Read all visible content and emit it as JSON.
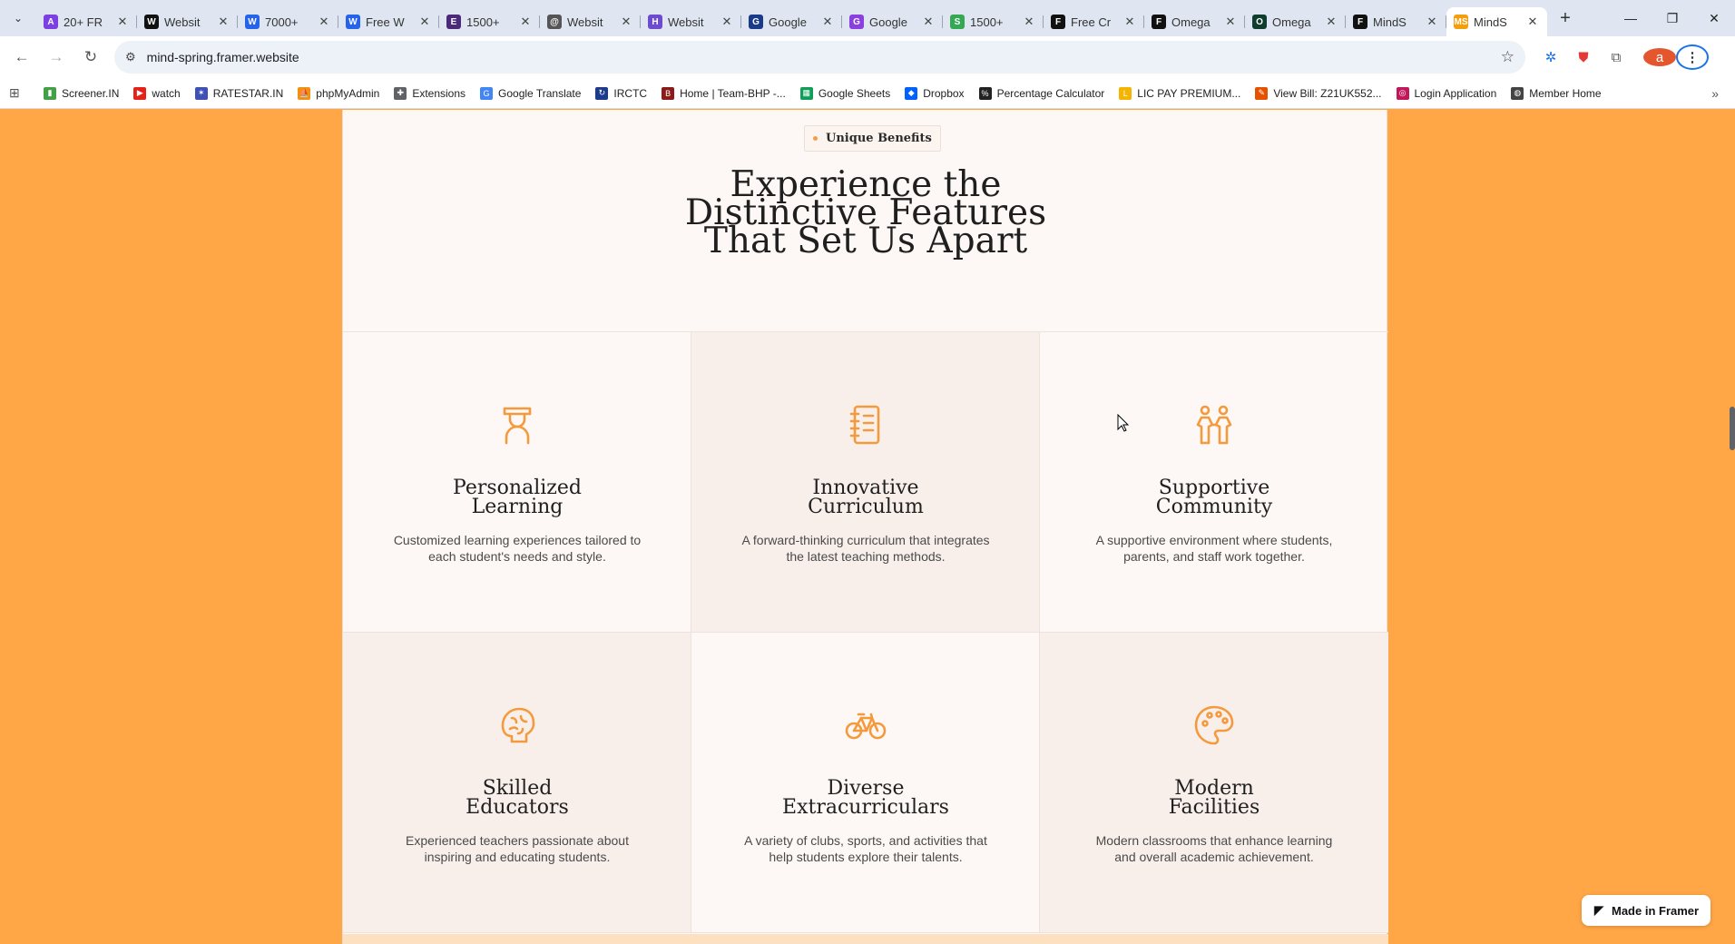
{
  "browser": {
    "tabs": [
      {
        "title": "20+ FR",
        "fav_color": "#7b3fe4",
        "fav_glyph": "A"
      },
      {
        "title": "Websit",
        "fav_color": "#111111",
        "fav_glyph": "W"
      },
      {
        "title": "7000+",
        "fav_color": "#2563eb",
        "fav_glyph": "W"
      },
      {
        "title": "Free W",
        "fav_color": "#2563eb",
        "fav_glyph": "W"
      },
      {
        "title": "1500+",
        "fav_color": "#4b2a7a",
        "fav_glyph": "E"
      },
      {
        "title": "Websit",
        "fav_color": "#555555",
        "fav_glyph": "@"
      },
      {
        "title": "Websit",
        "fav_color": "#6c4bd1",
        "fav_glyph": "H"
      },
      {
        "title": "Google",
        "fav_color": "#1a3a8a",
        "fav_glyph": "G"
      },
      {
        "title": "Google",
        "fav_color": "#8a3fe0",
        "fav_glyph": "G"
      },
      {
        "title": "1500+",
        "fav_color": "#34a853",
        "fav_glyph": "S"
      },
      {
        "title": "Free Cr",
        "fav_color": "#111111",
        "fav_glyph": "F"
      },
      {
        "title": "Omega",
        "fav_color": "#111111",
        "fav_glyph": "F"
      },
      {
        "title": "Omega",
        "fav_color": "#0f3d2e",
        "fav_glyph": "O"
      },
      {
        "title": "MindS",
        "fav_color": "#111111",
        "fav_glyph": "F"
      },
      {
        "title": "MindS",
        "fav_color": "#f59e0b",
        "fav_glyph": "MS"
      }
    ],
    "new_tab_label": "+",
    "url": "mind-spring.framer.website",
    "profile_initial": "a",
    "bookmarks": [
      {
        "label": "Screener.IN",
        "color": "#43a047",
        "glyph": "▮"
      },
      {
        "label": "watch",
        "color": "#e62117",
        "glyph": "▶"
      },
      {
        "label": "RATESTAR.IN",
        "color": "#3f51b5",
        "glyph": "✶"
      },
      {
        "label": "phpMyAdmin",
        "color": "#f29111",
        "glyph": "⛵"
      },
      {
        "label": "Extensions",
        "color": "#5f6368",
        "glyph": "✚"
      },
      {
        "label": "Google Translate",
        "color": "#4285f4",
        "glyph": "G"
      },
      {
        "label": "IRCTC",
        "color": "#1e3a8a",
        "glyph": "↻"
      },
      {
        "label": "Home | Team-BHP -...",
        "color": "#8b1a1a",
        "glyph": "B"
      },
      {
        "label": "Google Sheets",
        "color": "#0f9d58",
        "glyph": "▦"
      },
      {
        "label": "Dropbox",
        "color": "#0061ff",
        "glyph": "◆"
      },
      {
        "label": "Percentage Calculator",
        "color": "#222222",
        "glyph": "%"
      },
      {
        "label": "LIC PAY PREMIUM...",
        "color": "#f4b400",
        "glyph": "L"
      },
      {
        "label": "View Bill: Z21UK552...",
        "color": "#e65100",
        "glyph": "✎"
      },
      {
        "label": "Login Application",
        "color": "#c2185b",
        "glyph": "◎"
      },
      {
        "label": "Member Home",
        "color": "#444444",
        "glyph": "◍"
      }
    ]
  },
  "section": {
    "badge": "Unique Benefits",
    "heading_lines": [
      "Experience the",
      "Distinctive Features",
      "That Set Us Apart"
    ]
  },
  "features": [
    {
      "title_1": "Personalized",
      "title_2": "Learning",
      "desc": "Customized learning experiences tailored to each student's needs and style.",
      "icon": "student-icon"
    },
    {
      "title_1": "Innovative",
      "title_2": "Curriculum",
      "desc": "A forward-thinking curriculum that integrates the latest teaching methods.",
      "icon": "notebook-icon"
    },
    {
      "title_1": "Supportive",
      "title_2": "Community",
      "desc": "A supportive environment where students, parents, and staff work together.",
      "icon": "people-icon"
    },
    {
      "title_1": "Skilled",
      "title_2": "Educators",
      "desc": "Experienced teachers passionate about inspiring and educating students.",
      "icon": "brain-icon"
    },
    {
      "title_1": "Diverse",
      "title_2": "Extracurriculars",
      "desc": "A variety of clubs, sports, and activities that help students explore their talents.",
      "icon": "bicycle-icon"
    },
    {
      "title_1": "Modern",
      "title_2": "Facilities",
      "desc": "Modern classrooms that enhance learning and overall academic achievement.",
      "icon": "palette-icon"
    }
  ],
  "framer_badge": "Made in Framer",
  "colors": {
    "accent": "#f59a3c",
    "background": "#ffa646",
    "card": "#fdf8f5",
    "card_shaded": "#f8efeb"
  }
}
